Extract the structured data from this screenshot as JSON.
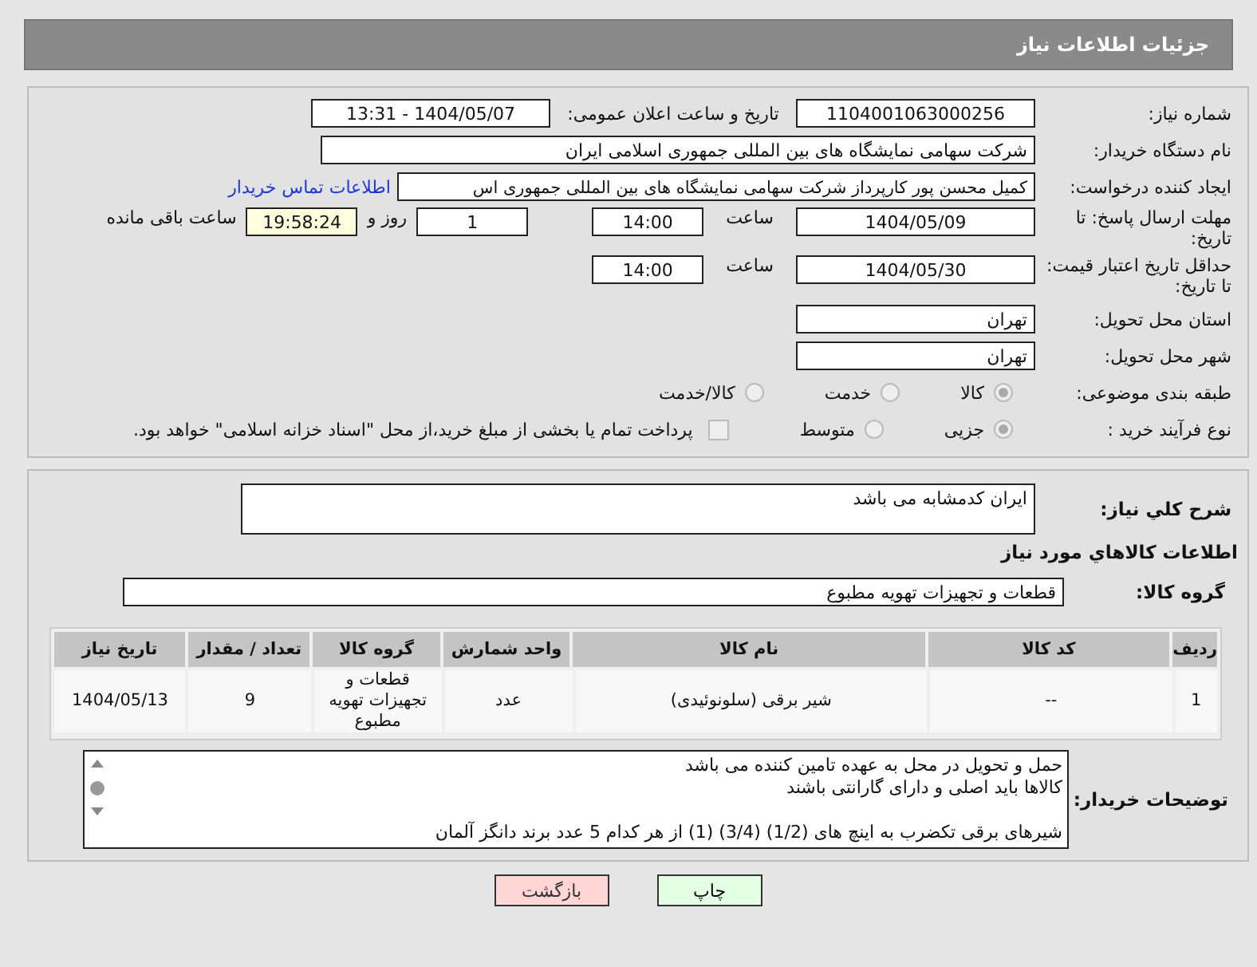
{
  "header": {
    "title": "جزئیات اطلاعات نیاز"
  },
  "need_number": {
    "label": "شماره نیاز:",
    "value": "1104001063000256"
  },
  "announce": {
    "label": "تاریخ و ساعت اعلان عمومی:",
    "value": "1404/05/07 - 13:31"
  },
  "buyer": {
    "label": "نام دستگاه خریدار:",
    "value": "شرکت سهامی نمایشگاه های بین المللی جمهوری اسلامی ایران"
  },
  "creator": {
    "label": "ایجاد کننده درخواست:",
    "value": "کمیل محسن پور کارپرداز شرکت سهامی نمایشگاه های بین المللی جمهوری اس",
    "link": "اطلاعات تماس خریدار"
  },
  "deadline": {
    "label": "مهلت ارسال پاسخ: تا تاریخ:",
    "date": "1404/05/09",
    "time_label": "ساعت",
    "time": "14:00",
    "days": "1",
    "days_label": "روز و",
    "remaining": "19:58:24",
    "remaining_label": "ساعت باقی مانده"
  },
  "validity": {
    "label": "حداقل تاریخ اعتبار قیمت: تا تاریخ:",
    "date": "1404/05/30",
    "time_label": "ساعت",
    "time": "14:00"
  },
  "province": {
    "label": "استان محل تحویل:",
    "value": "تهران"
  },
  "city": {
    "label": "شهر محل تحویل:",
    "value": "تهران"
  },
  "category": {
    "label": "طبقه بندی موضوعی:",
    "options": [
      {
        "label": "کالا",
        "selected": true
      },
      {
        "label": "خدمت",
        "selected": false
      },
      {
        "label": "کالا/خدمت",
        "selected": false
      }
    ]
  },
  "process": {
    "label": "نوع فرآیند خرید :",
    "options": [
      {
        "label": "جزیی",
        "selected": true
      },
      {
        "label": "متوسط",
        "selected": false
      }
    ],
    "treasury": {
      "label": "پرداخت تمام یا بخشی از مبلغ خرید،از محل \"اسناد خزانه اسلامی\" خواهد بود.",
      "checked": false
    }
  },
  "description": {
    "label": "شرح کلي نياز:",
    "value": "ایران کدمشابه می باشد"
  },
  "goods_heading": "اطلاعات کالاهاي مورد نياز",
  "goods_group": {
    "label": "گروه کالا:",
    "value": "قطعات و تجهیزات تهویه مطبوع"
  },
  "table": {
    "columns": [
      "ردیف",
      "کد کالا",
      "نام کالا",
      "واحد شمارش",
      "گروه کالا",
      "تعداد / مقدار",
      "تاریخ نیاز"
    ],
    "rows": [
      [
        "1",
        "--",
        "شیر برقی (سلونوئیدی)",
        "عدد",
        "قطعات و تجهیزات تهویه مطبوع",
        "9",
        "1404/05/13"
      ]
    ]
  },
  "buyer_notes": {
    "label": "توضیحات خریدار:",
    "paragraphs": [
      [
        "حمل و تحویل در محل به عهده تامین کننده می باشد",
        "کالاها باید اصلی و دارای گارانتی باشند"
      ],
      [
        "شیرهای برقی تکضرب به اینچ های (1/2) (3/4) (1) از هر کدام 5 عدد  برند دانگز آلمان"
      ]
    ]
  },
  "buttons": [
    {
      "kind": "print",
      "label": "چاپ"
    },
    {
      "kind": "back",
      "label": "بازگشت"
    }
  ]
}
